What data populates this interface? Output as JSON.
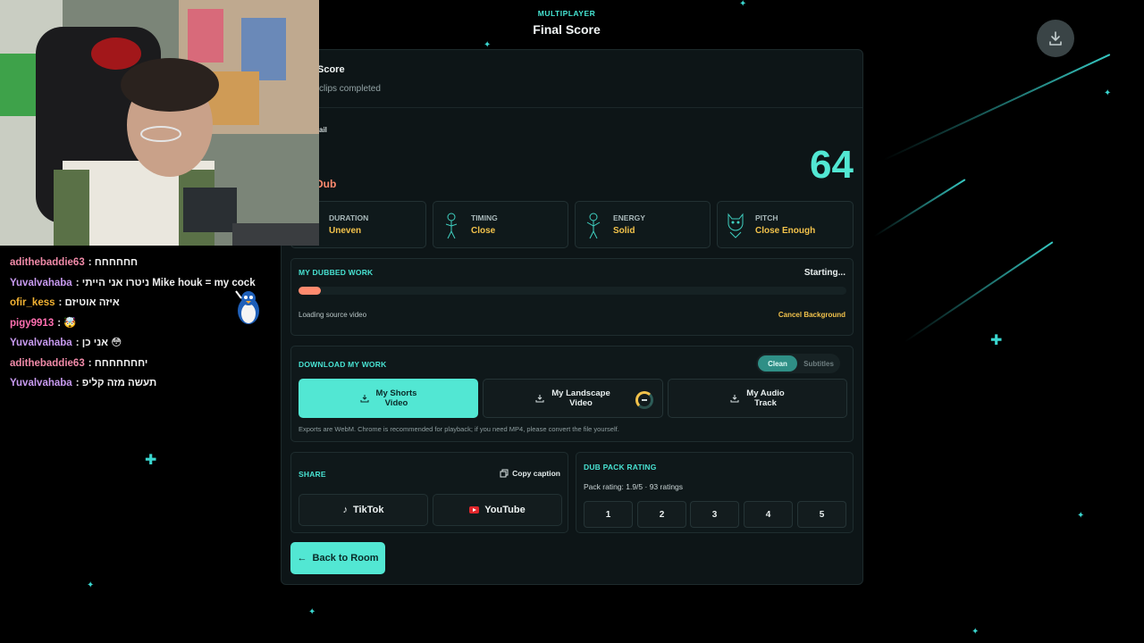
{
  "header": {
    "kicker": "MULTIPLAYER",
    "title": "Final Score"
  },
  "colors": {
    "accent": "#52e7d3",
    "progress": "#ff8a6e",
    "warning": "#f2c24b",
    "panel": "#0d1517"
  },
  "score_section": {
    "title": "Score",
    "subtitle": "clips completed",
    "detail_label": "ail",
    "dub_label": "Dub",
    "total": "64"
  },
  "metrics": [
    {
      "label": "DURATION",
      "value": "Uneven",
      "icon": "character-figure-icon"
    },
    {
      "label": "TIMING",
      "value": "Close",
      "icon": "character-figure-icon"
    },
    {
      "label": "ENERGY",
      "value": "Solid",
      "icon": "character-figure-icon"
    },
    {
      "label": "PITCH",
      "value": "Close Enough",
      "icon": "character-figure-icon"
    }
  ],
  "dubbed_work": {
    "heading": "MY DUBBED WORK",
    "status": "Starting...",
    "progress": 0.04,
    "message": "Loading source video",
    "cancel_label": "Cancel Background"
  },
  "download": {
    "heading": "DOWNLOAD MY WORK",
    "toggle": {
      "selected": "Clean",
      "other": "Subtitles"
    },
    "buttons": [
      {
        "line1": "My Shorts",
        "line2": "Video",
        "icon": "download-icon",
        "state": "primary"
      },
      {
        "line1": "My Landscape",
        "line2": "Video",
        "icon": "download-icon",
        "state": "loading"
      },
      {
        "line1": "My Audio",
        "line2": "Track",
        "icon": "download-icon",
        "state": "default"
      }
    ],
    "note": "Exports are WebM. Chrome is recommended for playback; if you need MP4, please convert the file yourself."
  },
  "share": {
    "heading": "SHARE",
    "copy_label": "Copy caption",
    "tiktok": "TikTok",
    "youtube": "YouTube"
  },
  "rating": {
    "heading": "DUB PACK RATING",
    "summary": "Pack rating: 1.9/5 · 93 ratings",
    "options": [
      "1",
      "2",
      "3",
      "4",
      "5"
    ]
  },
  "back_label": "Back to Room",
  "chat": [
    {
      "user": "adithebaddie63",
      "color": "#f08aa8",
      "text": ": חחחחחח"
    },
    {
      "user": "Yuvalvahaba",
      "color": "#c89af0",
      "text": ": ניטרו אני הייתי Mike houk = my cock"
    },
    {
      "user": "ofir_kess",
      "color": "#f2b233",
      "text": ": איזה אוטיזם"
    },
    {
      "user": "pigy9913",
      "color": "#ff6fb0",
      "text": ": 🤯"
    },
    {
      "user": "Yuvalvahaba",
      "color": "#c89af0",
      "text": ": אני כן 😳"
    },
    {
      "user": "adithebaddie63",
      "color": "#f08aa8",
      "text": ": יחחחחחחח"
    },
    {
      "user": "Yuvalvahaba",
      "color": "#c89af0",
      "text": ": תעשה מזה קליפ"
    }
  ]
}
